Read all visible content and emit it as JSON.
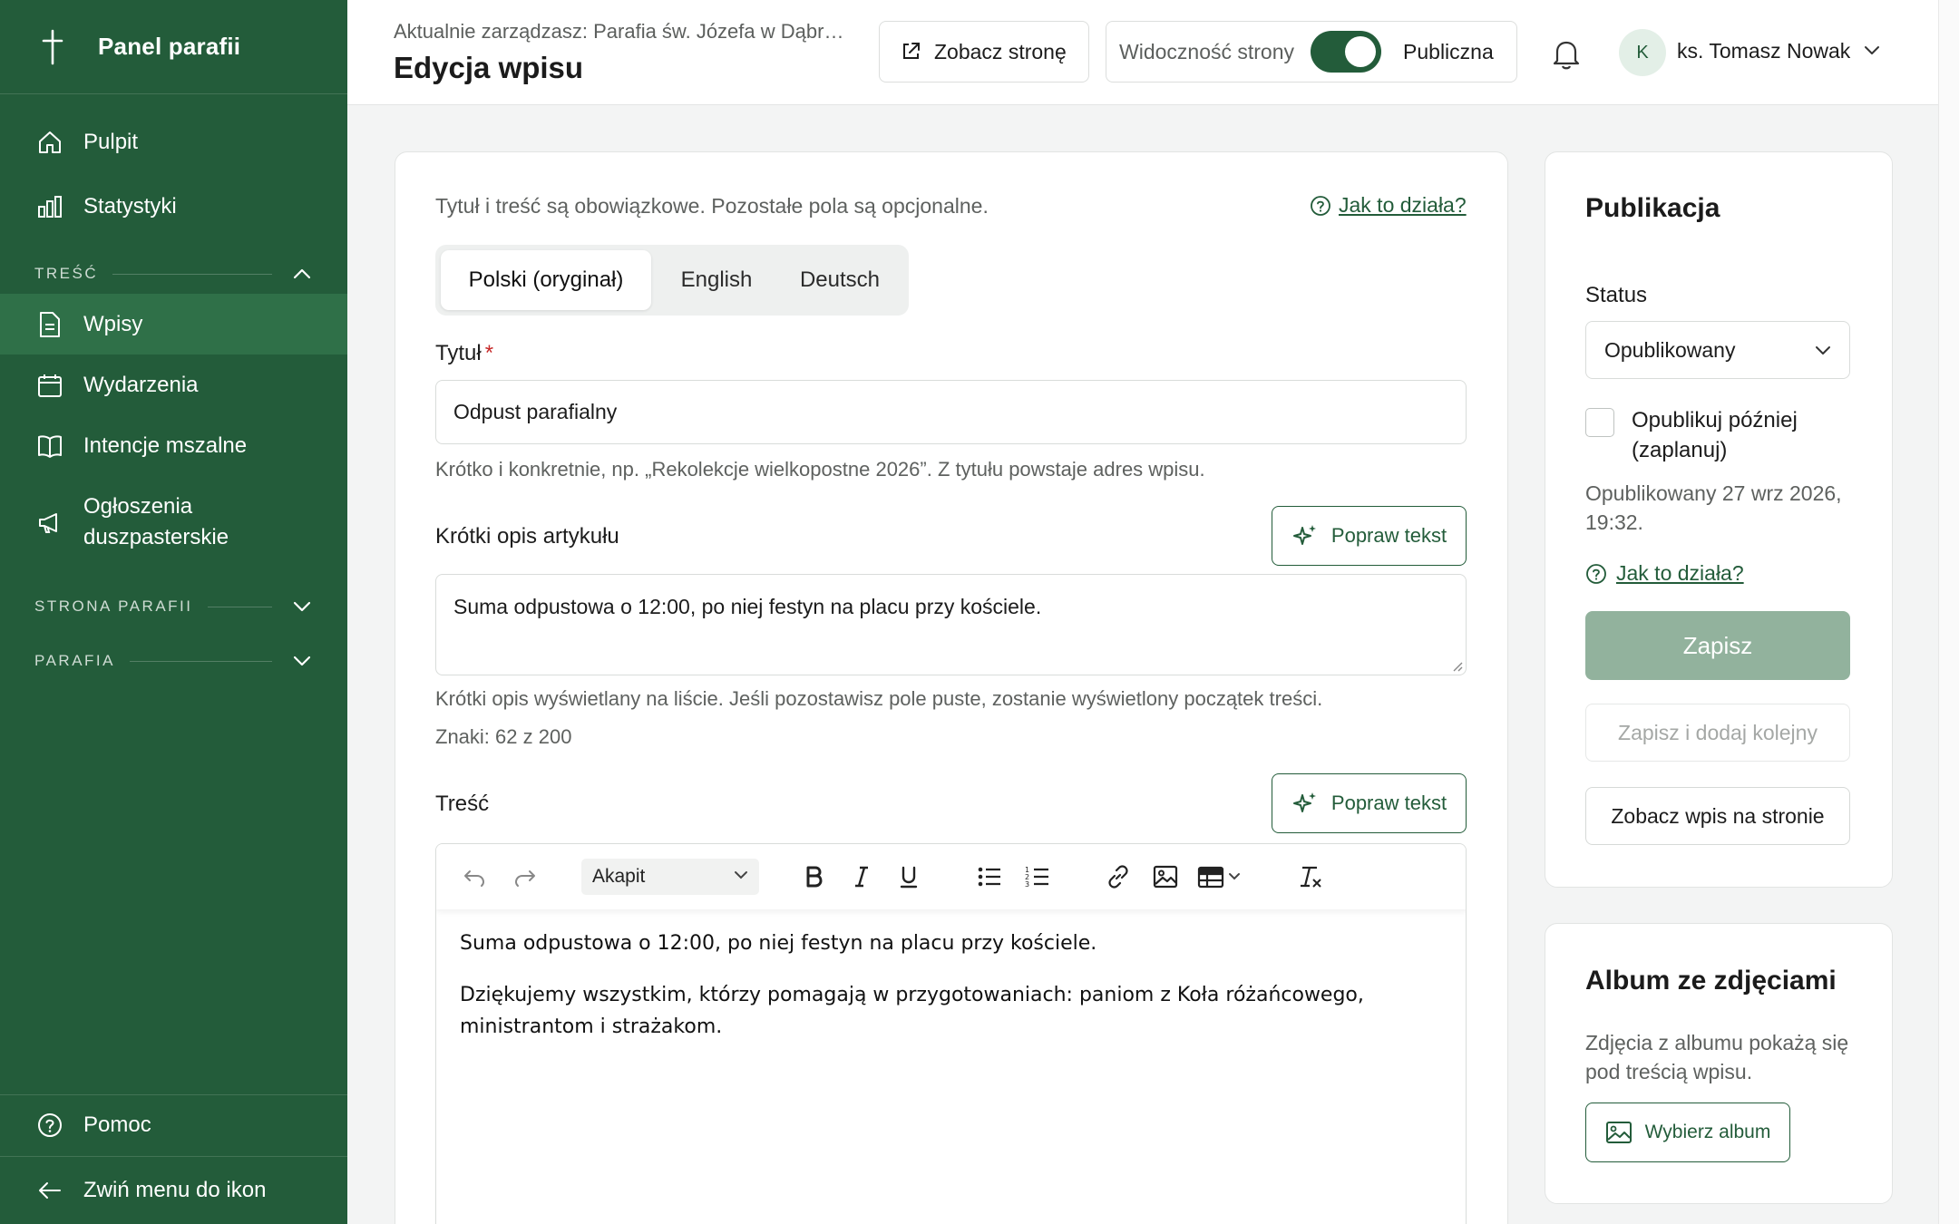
{
  "sidebar": {
    "brand": "Panel parafii",
    "items": [
      {
        "label": "Pulpit",
        "icon": "home-icon"
      },
      {
        "label": "Statystyki",
        "icon": "bar-chart-icon"
      }
    ],
    "sections": [
      {
        "label": "TREŚĆ",
        "expanded": true
      },
      {
        "label": "STRONA PARAFII",
        "expanded": false
      },
      {
        "label": "PARAFIA",
        "expanded": false
      }
    ],
    "content_items": [
      {
        "label": "Wpisy",
        "icon": "document-icon",
        "active": true
      },
      {
        "label": "Wydarzenia",
        "icon": "calendar-icon"
      },
      {
        "label": "Intencje mszalne",
        "icon": "book-icon"
      },
      {
        "label_line1": "Ogłoszenia",
        "label_line2": "duszpasterskie",
        "icon": "megaphone-icon"
      }
    ],
    "help": "Pomoc",
    "collapse": "Zwiń menu do ikon"
  },
  "header": {
    "context": "Aktualnie zarządzasz: Parafia św. Józefa w Dąbr…",
    "title": "Edycja wpisu",
    "view_site": "Zobacz stronę",
    "visibility_label": "Widoczność strony",
    "visibility_value": "Publiczna",
    "user_initial": "K",
    "user_name": "ks. Tomasz Nowak"
  },
  "form": {
    "intro": "Tytuł i treść są obowiązkowe. Pozostałe pola są opcjonalne.",
    "how_it_works": "Jak to działa?",
    "languages": [
      "Polski (oryginał)",
      "English",
      "Deutsch"
    ],
    "title_label": "Tytuł",
    "required_mark": "*",
    "title_value": "Odpust parafialny",
    "title_hint": "Krótko i konkretnie, np. „Rekolekcje wielkopostne 2026”. Z tytułu powstaje adres wpisu.",
    "summary_label": "Krótki opis artykułu",
    "improve_text": "Popraw tekst",
    "summary_value": "Suma odpustowa o 12:00, po niej festyn na placu przy kościele.",
    "summary_hint": "Krótki opis wyświetlany na liście. Jeśli pozostawisz pole puste, zostanie wyświetlony początek treści.",
    "char_count": "Znaki: 62 z 200",
    "content_label": "Treść",
    "paragraph_style": "Akapit",
    "content_p1": "Suma odpustowa o 12:00, po niej festyn na placu przy kościele.",
    "content_p2": "Dziękujemy wszystkim, którzy pomagają w przygotowaniach: paniom z Koła różańcowego, ministrantom i strażakom."
  },
  "publication": {
    "title": "Publikacja",
    "status_label": "Status",
    "status_value": "Opublikowany",
    "schedule_line1": "Opublikuj później",
    "schedule_line2": "(zaplanuj)",
    "published_line1": "Opublikowany 27 wrz 2026,",
    "published_line2": "19:32.",
    "how_it_works": "Jak to działa?",
    "save": "Zapisz",
    "save_and_add": "Zapisz i dodaj kolejny",
    "view_post": "Zobacz wpis na stronie"
  },
  "album": {
    "title": "Album ze zdjęciami",
    "desc_line1": "Zdjęcia z albumu pokażą się",
    "desc_line2": "pod treścią wpisu.",
    "choose": "Wybierz album"
  },
  "colors": {
    "sidebar_bg": "#235c3a",
    "active_item": "#2f7048",
    "accent": "#235c3a",
    "disabled_primary": "#92b29d"
  }
}
